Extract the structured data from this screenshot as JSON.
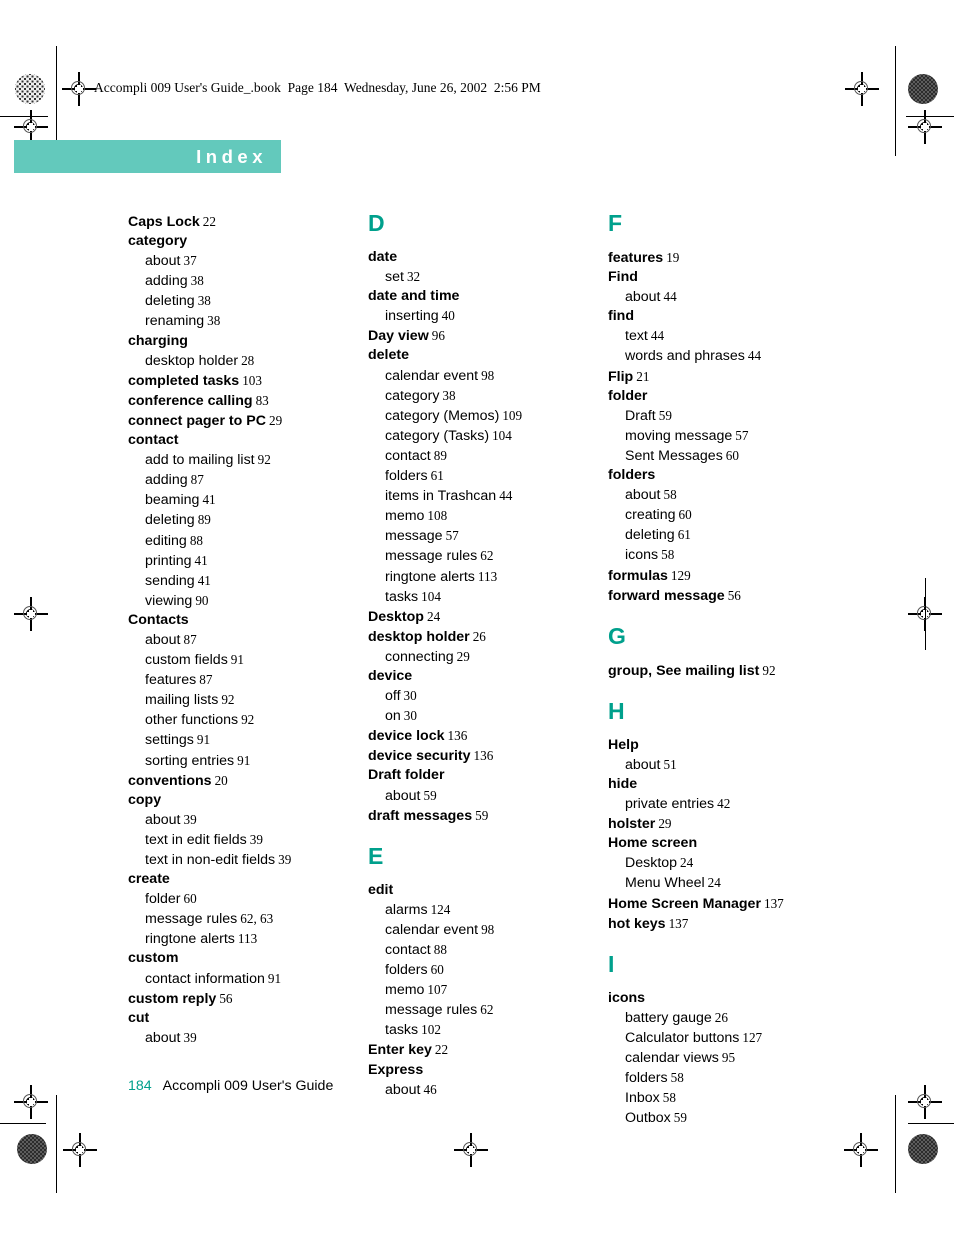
{
  "running_head": "Accompli 009 User's Guide_.book  Page 184  Wednesday, June 26, 2002  2:56 PM",
  "title_band": {
    "label": "Index",
    "band_color": "#63c9bc",
    "text_color": "#ffffff"
  },
  "accent_color": "#00a08c",
  "footer": {
    "page_number": "184",
    "book_title": "Accompli 009 User's Guide"
  },
  "columns": [
    {
      "id": "column-1",
      "blocks": [
        {
          "type": "entry",
          "label": "Caps Lock",
          "page": "22"
        },
        {
          "type": "entry",
          "label": "category",
          "page": ""
        },
        {
          "type": "subentry",
          "label": "about",
          "page": "37"
        },
        {
          "type": "subentry",
          "label": "adding",
          "page": "38"
        },
        {
          "type": "subentry",
          "label": "deleting",
          "page": "38"
        },
        {
          "type": "subentry",
          "label": "renaming",
          "page": "38"
        },
        {
          "type": "entry",
          "label": "charging",
          "page": ""
        },
        {
          "type": "subentry",
          "label": "desktop holder",
          "page": "28"
        },
        {
          "type": "entry",
          "label": "completed tasks",
          "page": "103"
        },
        {
          "type": "entry",
          "label": "conference calling",
          "page": "83"
        },
        {
          "type": "entry",
          "label": "connect pager to PC",
          "page": "29"
        },
        {
          "type": "entry",
          "label": "contact",
          "page": ""
        },
        {
          "type": "subentry",
          "label": "add to mailing list",
          "page": "92"
        },
        {
          "type": "subentry",
          "label": "adding",
          "page": "87"
        },
        {
          "type": "subentry",
          "label": "beaming",
          "page": "41"
        },
        {
          "type": "subentry",
          "label": "deleting",
          "page": "89"
        },
        {
          "type": "subentry",
          "label": "editing",
          "page": "88"
        },
        {
          "type": "subentry",
          "label": "printing",
          "page": "41"
        },
        {
          "type": "subentry",
          "label": "sending",
          "page": "41"
        },
        {
          "type": "subentry",
          "label": "viewing",
          "page": "90"
        },
        {
          "type": "entry",
          "label": "Contacts",
          "page": ""
        },
        {
          "type": "subentry",
          "label": "about",
          "page": "87"
        },
        {
          "type": "subentry",
          "label": "custom fields",
          "page": "91"
        },
        {
          "type": "subentry",
          "label": "features",
          "page": "87"
        },
        {
          "type": "subentry",
          "label": "mailing lists",
          "page": "92"
        },
        {
          "type": "subentry",
          "label": "other functions",
          "page": "92"
        },
        {
          "type": "subentry",
          "label": "settings",
          "page": "91"
        },
        {
          "type": "subentry",
          "label": "sorting entries",
          "page": "91"
        },
        {
          "type": "entry",
          "label": "conventions",
          "page": "20"
        },
        {
          "type": "entry",
          "label": "copy",
          "page": ""
        },
        {
          "type": "subentry",
          "label": "about",
          "page": "39"
        },
        {
          "type": "subentry",
          "label": "text in edit fields",
          "page": "39"
        },
        {
          "type": "subentry",
          "label": "text in non-edit fields",
          "page": "39"
        },
        {
          "type": "entry",
          "label": "create",
          "page": ""
        },
        {
          "type": "subentry",
          "label": "folder",
          "page": "60"
        },
        {
          "type": "subentry",
          "label": "message rules",
          "page": "62, 63"
        },
        {
          "type": "subentry",
          "label": "ringtone alerts",
          "page": "113"
        },
        {
          "type": "entry",
          "label": "custom",
          "page": ""
        },
        {
          "type": "subentry",
          "label": "contact information",
          "page": "91"
        },
        {
          "type": "entry",
          "label": "custom reply",
          "page": "56"
        },
        {
          "type": "entry",
          "label": "cut",
          "page": ""
        },
        {
          "type": "subentry",
          "label": "about",
          "page": "39"
        }
      ]
    },
    {
      "id": "column-2",
      "blocks": [
        {
          "type": "letter",
          "label": "D"
        },
        {
          "type": "entry",
          "label": "date",
          "page": ""
        },
        {
          "type": "subentry",
          "label": "set",
          "page": "32"
        },
        {
          "type": "entry",
          "label": "date and time",
          "page": ""
        },
        {
          "type": "subentry",
          "label": "inserting",
          "page": "40"
        },
        {
          "type": "entry",
          "label": "Day view",
          "page": "96"
        },
        {
          "type": "entry",
          "label": "delete",
          "page": ""
        },
        {
          "type": "subentry",
          "label": "calendar event",
          "page": "98"
        },
        {
          "type": "subentry",
          "label": "category",
          "page": "38"
        },
        {
          "type": "subentry",
          "label": "category (Memos)",
          "page": "109"
        },
        {
          "type": "subentry",
          "label": "category (Tasks)",
          "page": "104"
        },
        {
          "type": "subentry",
          "label": "contact",
          "page": "89"
        },
        {
          "type": "subentry",
          "label": "folders",
          "page": "61"
        },
        {
          "type": "subentry",
          "label": "items in Trashcan",
          "page": "44"
        },
        {
          "type": "subentry",
          "label": "memo",
          "page": "108"
        },
        {
          "type": "subentry",
          "label": "message",
          "page": "57"
        },
        {
          "type": "subentry",
          "label": "message rules",
          "page": "62"
        },
        {
          "type": "subentry",
          "label": "ringtone alerts",
          "page": "113"
        },
        {
          "type": "subentry",
          "label": "tasks",
          "page": "104"
        },
        {
          "type": "entry",
          "label": "Desktop",
          "page": "24"
        },
        {
          "type": "entry",
          "label": "desktop holder",
          "page": "26"
        },
        {
          "type": "subentry",
          "label": "connecting",
          "page": "29"
        },
        {
          "type": "entry",
          "label": "device",
          "page": ""
        },
        {
          "type": "subentry",
          "label": "off",
          "page": "30"
        },
        {
          "type": "subentry",
          "label": "on",
          "page": "30"
        },
        {
          "type": "entry",
          "label": "device lock",
          "page": "136"
        },
        {
          "type": "entry",
          "label": "device security",
          "page": "136"
        },
        {
          "type": "entry",
          "label": "Draft folder",
          "page": ""
        },
        {
          "type": "subentry",
          "label": "about",
          "page": "59"
        },
        {
          "type": "entry",
          "label": "draft messages",
          "page": "59"
        },
        {
          "type": "letter",
          "label": "E"
        },
        {
          "type": "entry",
          "label": "edit",
          "page": ""
        },
        {
          "type": "subentry",
          "label": "alarms",
          "page": "124"
        },
        {
          "type": "subentry",
          "label": "calendar event",
          "page": "98"
        },
        {
          "type": "subentry",
          "label": "contact",
          "page": "88"
        },
        {
          "type": "subentry",
          "label": "folders",
          "page": "60"
        },
        {
          "type": "subentry",
          "label": "memo",
          "page": "107"
        },
        {
          "type": "subentry",
          "label": "message rules",
          "page": "62"
        },
        {
          "type": "subentry",
          "label": "tasks",
          "page": "102"
        },
        {
          "type": "entry",
          "label": "Enter key",
          "page": "22"
        },
        {
          "type": "entry",
          "label": "Express",
          "page": ""
        },
        {
          "type": "subentry",
          "label": "about",
          "page": "46"
        }
      ]
    },
    {
      "id": "column-3",
      "blocks": [
        {
          "type": "letter",
          "label": "F"
        },
        {
          "type": "entry",
          "label": "features",
          "page": "19"
        },
        {
          "type": "entry",
          "label": "Find",
          "page": ""
        },
        {
          "type": "subentry",
          "label": "about",
          "page": "44"
        },
        {
          "type": "entry",
          "label": "find",
          "page": ""
        },
        {
          "type": "subentry",
          "label": "text",
          "page": "44"
        },
        {
          "type": "subentry",
          "label": "words and phrases",
          "page": "44"
        },
        {
          "type": "entry",
          "label": "Flip",
          "page": "21"
        },
        {
          "type": "entry",
          "label": "folder",
          "page": ""
        },
        {
          "type": "subentry",
          "label": "Draft",
          "page": "59"
        },
        {
          "type": "subentry",
          "label": "moving message",
          "page": "57"
        },
        {
          "type": "subentry",
          "label": "Sent Messages",
          "page": "60"
        },
        {
          "type": "entry",
          "label": "folders",
          "page": ""
        },
        {
          "type": "subentry",
          "label": "about",
          "page": "58"
        },
        {
          "type": "subentry",
          "label": "creating",
          "page": "60"
        },
        {
          "type": "subentry",
          "label": "deleting",
          "page": "61"
        },
        {
          "type": "subentry",
          "label": "icons",
          "page": "58"
        },
        {
          "type": "entry",
          "label": "formulas",
          "page": "129"
        },
        {
          "type": "entry",
          "label": "forward message",
          "page": "56"
        },
        {
          "type": "letter",
          "label": "G"
        },
        {
          "type": "entry",
          "label": "group, See mailing list",
          "page": "92"
        },
        {
          "type": "letter",
          "label": "H"
        },
        {
          "type": "entry",
          "label": "Help",
          "page": ""
        },
        {
          "type": "subentry",
          "label": "about",
          "page": "51"
        },
        {
          "type": "entry",
          "label": "hide",
          "page": ""
        },
        {
          "type": "subentry",
          "label": "private entries",
          "page": "42"
        },
        {
          "type": "entry",
          "label": "holster",
          "page": "29"
        },
        {
          "type": "entry",
          "label": "Home screen",
          "page": ""
        },
        {
          "type": "subentry",
          "label": "Desktop",
          "page": "24"
        },
        {
          "type": "subentry",
          "label": "Menu Wheel",
          "page": "24"
        },
        {
          "type": "entry",
          "label": "Home Screen Manager",
          "page": "137"
        },
        {
          "type": "entry",
          "label": "hot keys",
          "page": "137"
        },
        {
          "type": "letter",
          "label": "I"
        },
        {
          "type": "entry",
          "label": "icons",
          "page": ""
        },
        {
          "type": "subentry",
          "label": "battery gauge",
          "page": "26"
        },
        {
          "type": "subentry",
          "label": "Calculator buttons",
          "page": "127"
        },
        {
          "type": "subentry",
          "label": "calendar views",
          "page": "95"
        },
        {
          "type": "subentry",
          "label": "folders",
          "page": "58"
        },
        {
          "type": "subentry",
          "label": "Inbox",
          "page": "58"
        },
        {
          "type": "subentry",
          "label": "Outbox",
          "page": "59"
        }
      ]
    }
  ]
}
